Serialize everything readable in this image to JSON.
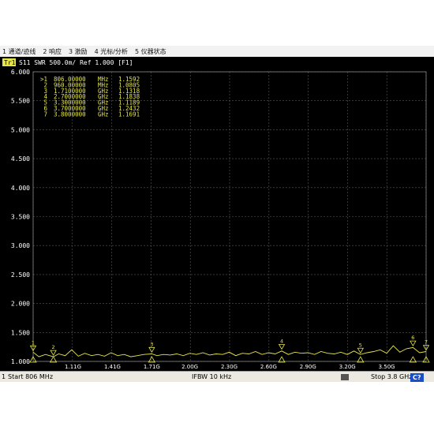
{
  "menu": {
    "items": [
      "1 通道/迹线",
      "2 响应",
      "3 激励",
      "4 光标/分析",
      "5 仪器状态"
    ]
  },
  "trace_header": {
    "trace_id": "Tr1",
    "text": "S11  SWR 500.0m/ Ref 1.000 [F1]"
  },
  "marker_table": [
    {
      "id": ">1",
      "freq": "806.00000",
      "unit": "MHz",
      "value": "1.1592"
    },
    {
      "id": "2",
      "freq": "960.00000",
      "unit": "MHz",
      "value": "1.0805"
    },
    {
      "id": "3",
      "freq": "1.7100000",
      "unit": "GHz",
      "value": "1.1318"
    },
    {
      "id": "4",
      "freq": "2.7000000",
      "unit": "GHz",
      "value": "1.1838"
    },
    {
      "id": "5",
      "freq": "3.3000000",
      "unit": "GHz",
      "value": "1.1189"
    },
    {
      "id": "6",
      "freq": "3.7000000",
      "unit": "GHz",
      "value": "1.2432"
    },
    {
      "id": "7",
      "freq": "3.8000000",
      "unit": "GHz",
      "value": "1.1691"
    }
  ],
  "status": {
    "channel": "1",
    "start": "Start 806 MHz",
    "ifbw": "IFBW 10 kHz",
    "stop": "Stop 3.8 GHz",
    "cal": "C?"
  },
  "colors": {
    "trace": "#e6e64a",
    "grid": "#5a5a5a",
    "text": "#ffffff",
    "marker_text": "#e6e64a",
    "background": "#000000",
    "trace_badge": "#e6e64a"
  },
  "chart_data": {
    "type": "line",
    "title": "S11  SWR 500.0m/ Ref 1.000 [F1]",
    "xlabel": "",
    "ylabel": "",
    "x_unit": "GHz",
    "xlim": [
      0.806,
      3.8
    ],
    "ylim": [
      1.0,
      6.0
    ],
    "ytick_labels": [
      "6.000",
      "5.500",
      "5.000",
      "4.500",
      "4.000",
      "3.500",
      "3.000",
      "2.500",
      "2.000",
      "1.500",
      "1.000"
    ],
    "yticks": [
      6.0,
      5.5,
      5.0,
      4.5,
      4.0,
      3.5,
      3.0,
      2.5,
      2.0,
      1.5,
      1.0
    ],
    "xtick_labels": [
      "1.11G",
      "1.41G",
      "1.71G",
      "2.00G",
      "2.30G",
      "2.60G",
      "2.90G",
      "3.20G",
      "3.50G"
    ],
    "xticks": [
      1.11,
      1.41,
      1.71,
      2.0,
      2.3,
      2.6,
      2.9,
      3.2,
      3.5
    ],
    "grid": true,
    "series": [
      {
        "x": [
          0.806,
          0.85,
          0.9,
          0.96,
          1.0,
          1.05,
          1.1,
          1.15,
          1.2,
          1.25,
          1.3,
          1.35,
          1.4,
          1.45,
          1.5,
          1.55,
          1.6,
          1.65,
          1.71,
          1.75,
          1.8,
          1.85,
          1.9,
          1.95,
          2.0,
          2.05,
          2.1,
          2.15,
          2.2,
          2.25,
          2.3,
          2.35,
          2.4,
          2.45,
          2.5,
          2.55,
          2.6,
          2.65,
          2.7,
          2.75,
          2.8,
          2.85,
          2.9,
          2.95,
          3.0,
          3.05,
          3.1,
          3.15,
          3.2,
          3.25,
          3.3,
          3.35,
          3.4,
          3.45,
          3.5,
          3.55,
          3.6,
          3.65,
          3.7,
          3.75,
          3.8
        ],
        "y": [
          1.16,
          1.08,
          1.12,
          1.08,
          1.13,
          1.1,
          1.2,
          1.09,
          1.14,
          1.1,
          1.12,
          1.09,
          1.15,
          1.1,
          1.12,
          1.08,
          1.1,
          1.12,
          1.13,
          1.1,
          1.12,
          1.11,
          1.13,
          1.1,
          1.14,
          1.12,
          1.15,
          1.11,
          1.13,
          1.12,
          1.16,
          1.1,
          1.14,
          1.13,
          1.17,
          1.12,
          1.15,
          1.13,
          1.18,
          1.12,
          1.16,
          1.14,
          1.15,
          1.12,
          1.17,
          1.14,
          1.13,
          1.16,
          1.12,
          1.18,
          1.12,
          1.15,
          1.17,
          1.2,
          1.14,
          1.27,
          1.16,
          1.22,
          1.24,
          1.15,
          1.17
        ]
      }
    ],
    "markers": [
      {
        "id": "1",
        "x": 0.806,
        "y": 1.1592
      },
      {
        "id": "2",
        "x": 0.96,
        "y": 1.0805
      },
      {
        "id": "3",
        "x": 1.71,
        "y": 1.1318
      },
      {
        "id": "4",
        "x": 2.7,
        "y": 1.1838
      },
      {
        "id": "5",
        "x": 3.3,
        "y": 1.1189
      },
      {
        "id": "6",
        "x": 3.7,
        "y": 1.2432
      },
      {
        "id": "7",
        "x": 3.8,
        "y": 1.1691
      }
    ]
  }
}
